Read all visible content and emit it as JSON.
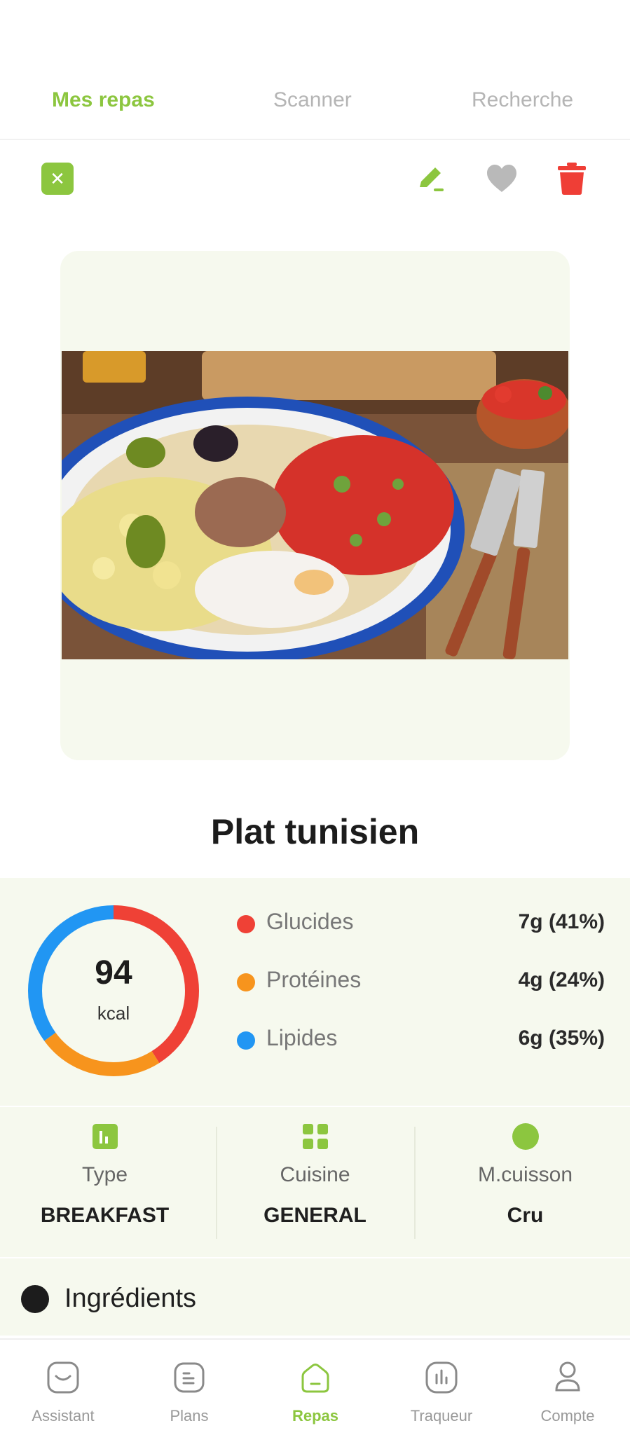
{
  "top_tabs": [
    {
      "label": "Mes repas",
      "active": true
    },
    {
      "label": "Scanner",
      "active": false
    },
    {
      "label": "Recherche",
      "active": false
    }
  ],
  "actions": {
    "close_icon": "close-icon",
    "edit_icon": "edit-icon",
    "favorite_icon": "heart-icon",
    "delete_icon": "trash-icon"
  },
  "meal": {
    "title": "Plat tunisien"
  },
  "nutrition": {
    "kcal_value": "94",
    "kcal_unit": "kcal",
    "macros": [
      {
        "name": "Glucides",
        "value": "7g (41%)",
        "percent": 41,
        "color": "#ef4136"
      },
      {
        "name": "Protéines",
        "value": "4g (24%)",
        "percent": 24,
        "color": "#f7941d"
      },
      {
        "name": "Lipides",
        "value": "6g (35%)",
        "percent": 35,
        "color": "#2196f3"
      }
    ]
  },
  "info": [
    {
      "label": "Type",
      "value": "BREAKFAST",
      "icon": "type-chart-icon"
    },
    {
      "label": "Cuisine",
      "value": "GENERAL",
      "icon": "grid-icon"
    },
    {
      "label": "M.cuisson",
      "value": "Cru",
      "icon": "circle-icon"
    }
  ],
  "ingredients": {
    "label": "Ingrédients"
  },
  "bottom_nav": [
    {
      "label": "Assistant",
      "icon": "chat-icon",
      "active": false
    },
    {
      "label": "Plans",
      "icon": "plans-icon",
      "active": false
    },
    {
      "label": "Repas",
      "icon": "home-icon",
      "active": true
    },
    {
      "label": "Traqueur",
      "icon": "chart-icon",
      "active": false
    },
    {
      "label": "Compte",
      "icon": "user-icon",
      "active": false
    }
  ],
  "colors": {
    "accent": "#8cc63f",
    "delete": "#ef3e36",
    "favorite": "#b9b9b9",
    "panel": "#f6f9ee"
  }
}
